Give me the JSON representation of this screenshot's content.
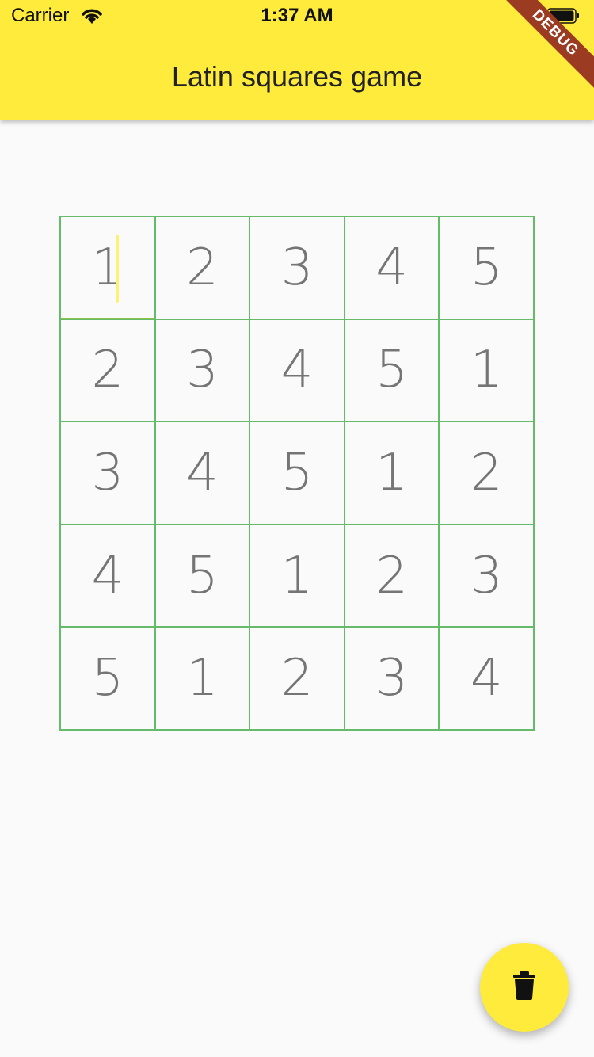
{
  "status_bar": {
    "carrier": "Carrier",
    "time": "1:37 AM",
    "wifi_icon": "wifi-icon",
    "battery_icon": "battery-icon"
  },
  "app_bar": {
    "title": "Latin squares game"
  },
  "debug_banner": {
    "label": "DEBUG",
    "color": "#9b3b22"
  },
  "grid": {
    "border_color": "#66bb6a",
    "focused_cell": "0-0",
    "rows": [
      [
        "1",
        "2",
        "3",
        "4",
        "5"
      ],
      [
        "2",
        "3",
        "4",
        "5",
        "1"
      ],
      [
        "3",
        "4",
        "5",
        "1",
        "2"
      ],
      [
        "4",
        "5",
        "1",
        "2",
        "3"
      ],
      [
        "5",
        "1",
        "2",
        "3",
        "4"
      ]
    ]
  },
  "fab": {
    "icon": "trash-icon",
    "color": "#ffeb3b"
  },
  "colors": {
    "app_bar": "#ffeb3b",
    "background": "#fafafa",
    "cell_text": "#757575",
    "focus_underline": "#8bc34a"
  }
}
